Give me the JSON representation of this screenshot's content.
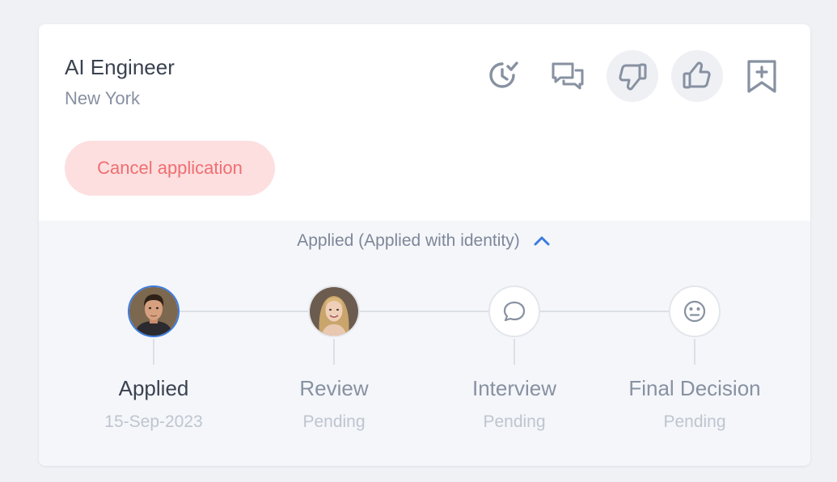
{
  "job": {
    "title": "AI Engineer",
    "location": "New York"
  },
  "actions": [
    {
      "name": "schedule-icon"
    },
    {
      "name": "chat-icon"
    },
    {
      "name": "thumbs-down-icon"
    },
    {
      "name": "thumbs-up-icon"
    },
    {
      "name": "bookmark-add-icon"
    }
  ],
  "cancel_label": "Cancel application",
  "status": {
    "text": "Applied (Applied with identity)",
    "toggle_icon": "chevron-up-icon"
  },
  "steps": [
    {
      "label": "Applied",
      "sub": "15-Sep-2023",
      "icon": "avatar-male",
      "active": true
    },
    {
      "label": "Review",
      "sub": "Pending",
      "icon": "avatar-female",
      "active": false
    },
    {
      "label": "Interview",
      "sub": "Pending",
      "icon": "speech-bubble-icon",
      "active": false
    },
    {
      "label": "Final Decision",
      "sub": "Pending",
      "icon": "neutral-face-icon",
      "active": false
    }
  ],
  "colors": {
    "accent": "#3b7be0",
    "danger_text": "#ef6e70",
    "danger_bg": "#fddfe0",
    "icon": "#8791a1"
  }
}
